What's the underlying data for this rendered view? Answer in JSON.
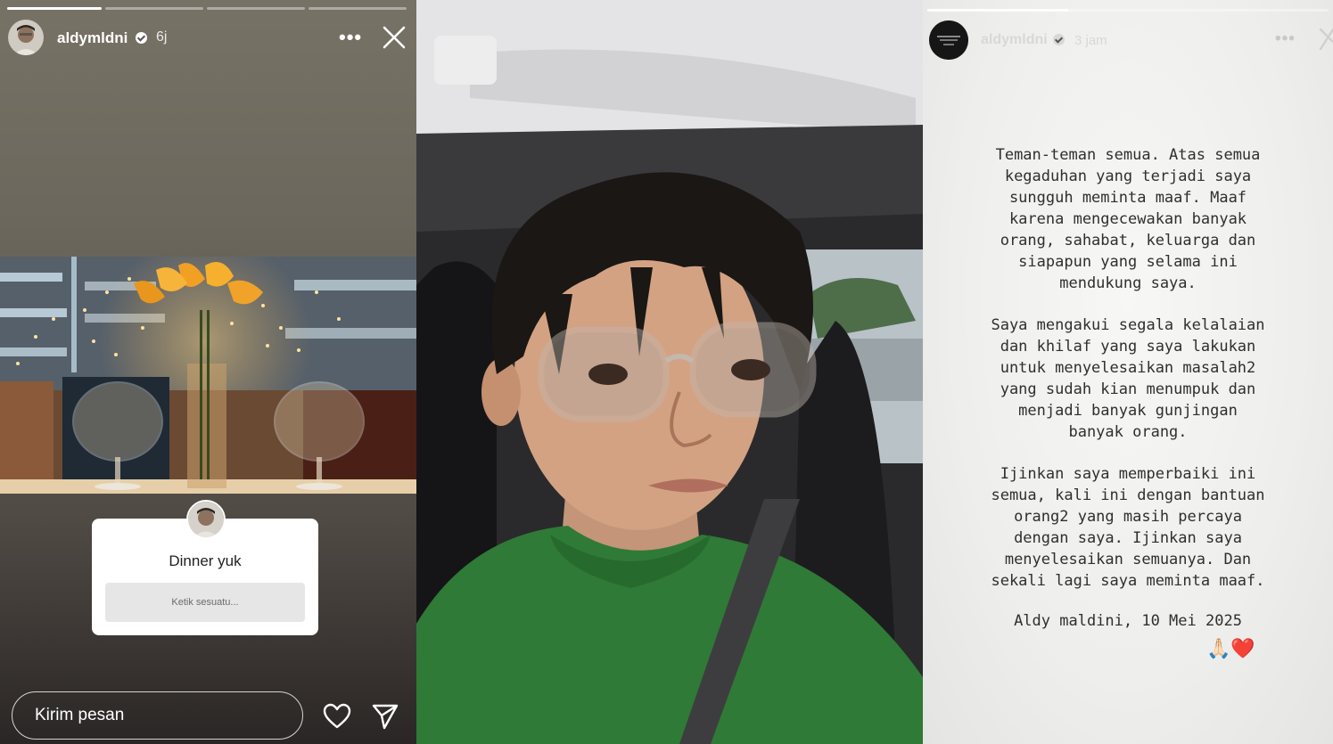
{
  "story_left": {
    "username": "aldymldni",
    "time": "6j",
    "more_label": "•••",
    "progress": [
      1.0,
      0,
      0,
      0
    ],
    "sticker": {
      "question": "Dinner yuk",
      "input_placeholder": "Ketik sesuatu..."
    },
    "reply_placeholder": "Kirim pesan",
    "icons": [
      "close-icon",
      "heart-icon",
      "send-icon",
      "verified-badge-icon"
    ]
  },
  "story_right": {
    "username": "aldymldni",
    "time": "3 jam",
    "more_label": "•••",
    "progress": [
      0.35
    ],
    "paragraphs": [
      "Teman-teman semua. Atas semua\nkegaduhan yang terjadi saya\nsungguh meminta maaf. Maaf\nkarena mengecewakan banyak\norang, sahabat, keluarga dan\nsiapapun yang selama ini\nmendukung saya.",
      "Saya mengakui segala kelalaian\ndan khilaf yang saya lakukan\nuntuk menyelesaikan masalah2\nyang sudah kian menumpuk dan\nmenjadi banyak gunjingan\nbanyak orang.",
      "Ijinkan saya memperbaiki ini\nsemua, kali ini dengan bantuan\norang2 yang masih percaya\ndengan saya. Ijinkan saya\nmenyelesaikan semuanya. Dan\nsekali lagi saya meminta maaf."
    ],
    "signature": "Aldy maldini, 10 Mei 2025",
    "emoji": "🙏🏻❤️"
  },
  "colors": {
    "left_bg": "#6c675c",
    "statement_bg": "#eeeeec",
    "sweater": "#2f7a36"
  }
}
